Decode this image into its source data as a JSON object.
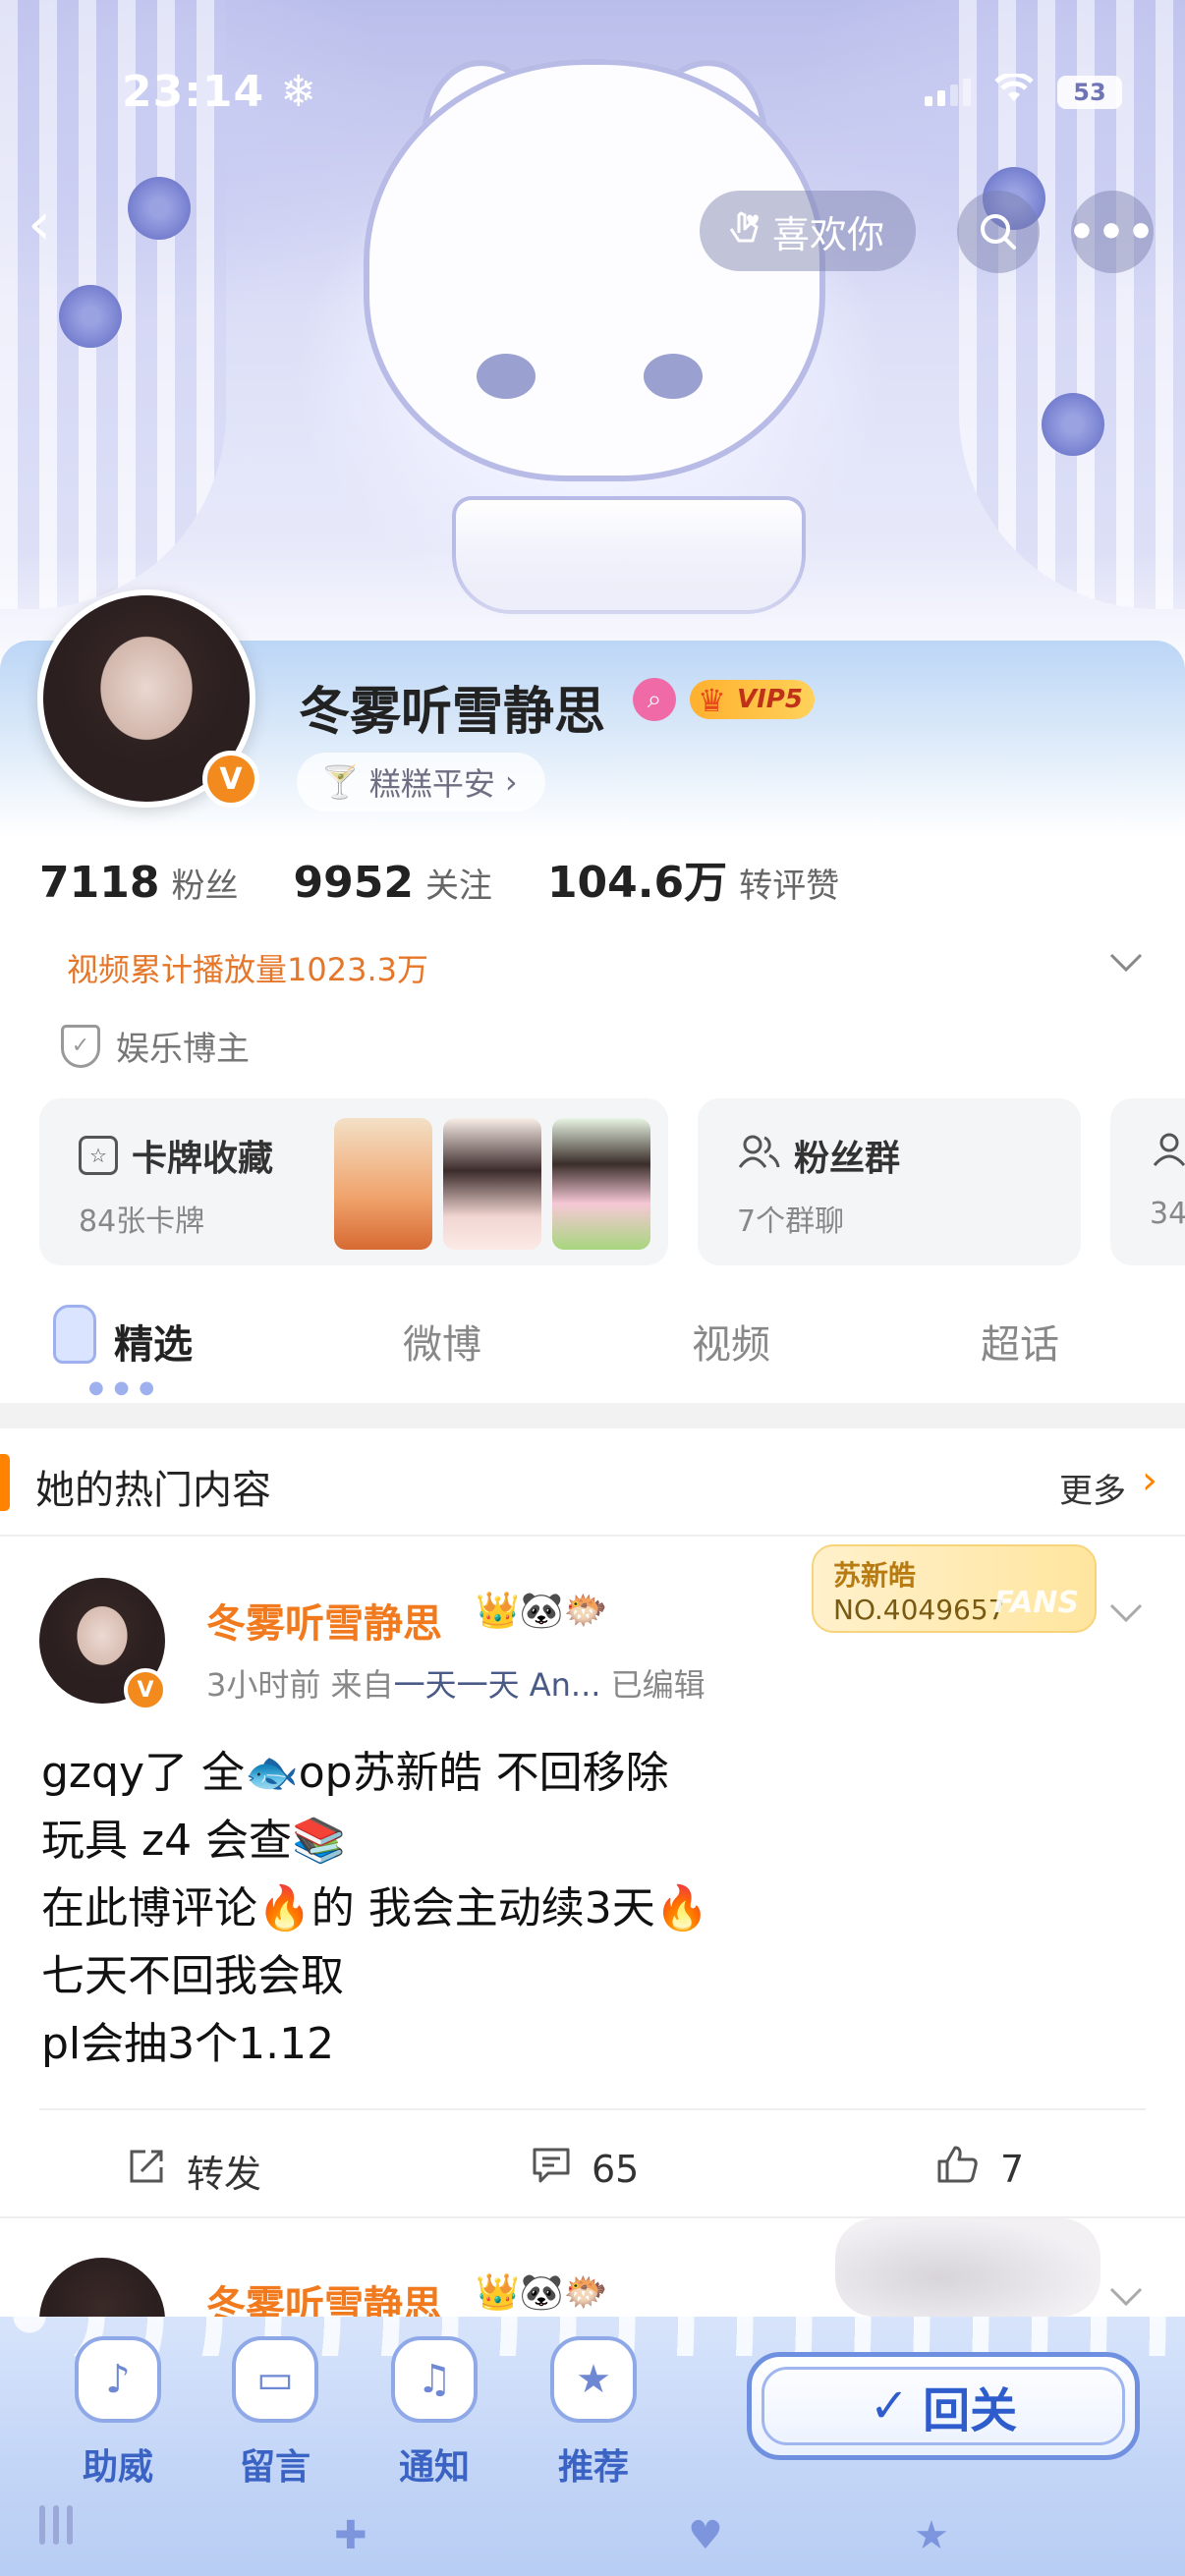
{
  "status_bar": {
    "time": "23:14",
    "time_icon": "snowflake-icon",
    "battery": "53"
  },
  "header": {
    "like_label": "喜欢你",
    "icons": {
      "back": "chevron-left-icon",
      "search": "search-icon",
      "more": "more-dots-icon"
    }
  },
  "profile": {
    "username": "冬雾听雪静思",
    "vip_label": "VIP5",
    "title_pill": "糕糕平安",
    "verified_mark": "V",
    "stats": [
      {
        "num": "7118",
        "label": "粉丝"
      },
      {
        "num": "9952",
        "label": "关注"
      },
      {
        "num": "104.6万",
        "label": "转评赞"
      }
    ],
    "video_plays": "视频累计播放量1023.3万",
    "verify_label": "娱乐博主"
  },
  "cards": {
    "collection": {
      "title": "卡牌收藏",
      "sub": "84张卡牌"
    },
    "fans_group": {
      "title": "粉丝群",
      "sub": "7个群聊"
    },
    "more_sub": "34"
  },
  "tabs": [
    {
      "label": "精选",
      "active": true
    },
    {
      "label": "微博",
      "active": false
    },
    {
      "label": "视频",
      "active": false
    },
    {
      "label": "超话",
      "active": false
    }
  ],
  "hot": {
    "title": "她的热门内容",
    "more": "更多"
  },
  "post": {
    "author": "冬雾听雪静思",
    "emojis": "👑🐼🐡",
    "time": "3小时前",
    "from_prefix": "来自",
    "source": "一天一天 An...",
    "edited": "已编辑",
    "fans_badge": {
      "name": "苏新皓",
      "number": "NO.4049657",
      "word": "FANS"
    },
    "lines": [
      "gzqy了 全🐟op苏新皓 不回移除",
      "玩具 z4 会查📚",
      "在此博评论🔥的 我会主动续3天🔥",
      "七天不回我会取",
      "pl会抽3个1.12"
    ],
    "actions": {
      "repost": "转发",
      "comments": "65",
      "likes": "7"
    }
  },
  "post2": {
    "author": "冬雾听雪静思",
    "emojis": "👑🐼🐡"
  },
  "bottom_bar": {
    "items": [
      {
        "label": "助威"
      },
      {
        "label": "留言"
      },
      {
        "label": "通知"
      },
      {
        "label": "推荐"
      }
    ],
    "follow_back": "回关"
  },
  "colors": {
    "accent_orange": "#ff8200",
    "username_orange": "#f07a1d",
    "bottom_blue": "#3b63c4"
  }
}
